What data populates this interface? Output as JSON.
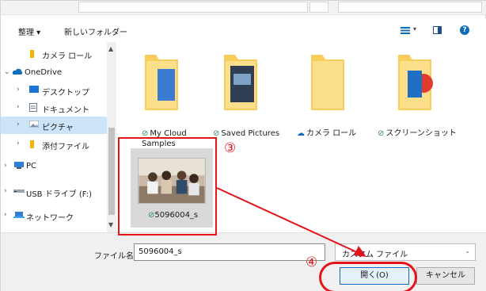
{
  "toolbar": {
    "organize_label": "整理 ▾",
    "new_folder_label": "新しいフォルダー",
    "view_dropdown": "▾",
    "help_label": "?"
  },
  "sidebar": {
    "items": [
      {
        "label": "カメラ ロール",
        "icon": "folder-icon"
      },
      {
        "label": "OneDrive",
        "icon": "cloud-icon"
      },
      {
        "label": "デスクトップ",
        "icon": "desktop-icon"
      },
      {
        "label": "ドキュメント",
        "icon": "document-icon"
      },
      {
        "label": "ピクチャ",
        "icon": "pictures-icon",
        "selected": true
      },
      {
        "label": "添付ファイル",
        "icon": "folder-icon"
      },
      {
        "label": "PC",
        "icon": "pc-icon"
      },
      {
        "label": "USB ドライブ (F:)",
        "icon": "usb-drive-icon"
      },
      {
        "label": "ネットワーク",
        "icon": "network-icon"
      }
    ]
  },
  "folders": [
    {
      "line1": "My Cloud",
      "line2": "Samples",
      "status": "synced"
    },
    {
      "line1": "Saved Pictures",
      "status": "synced"
    },
    {
      "line1": "カメラ ロール",
      "status": "cloud"
    },
    {
      "line1": "スクリーンショット",
      "status": "synced"
    }
  ],
  "selected_file": {
    "name": "5096004_s",
    "status": "synced"
  },
  "filename": {
    "label": "ファイル名(N):",
    "value": "5096004_s"
  },
  "filetype": {
    "value": "カスタム ファイル"
  },
  "buttons": {
    "open_label": "開く(O)",
    "cancel_label": "キャンセル"
  },
  "annotations": {
    "step3": "③",
    "step4": "④",
    "color": "#e3151a"
  },
  "colors": {
    "accent": "#0f6cbd",
    "selection": "#cce4f7",
    "folder": "#f5c542"
  }
}
